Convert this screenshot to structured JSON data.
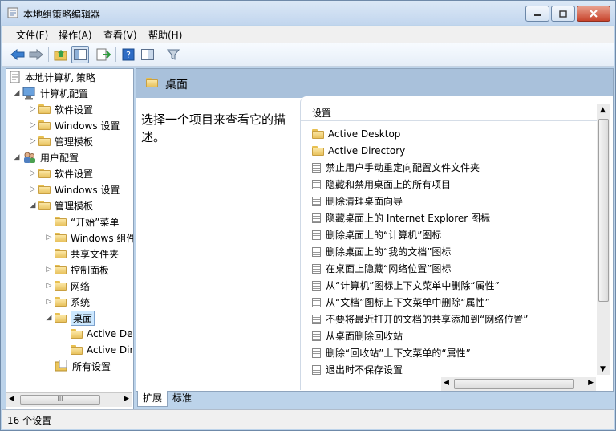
{
  "window": {
    "title": "本地组策略编辑器"
  },
  "menu": [
    "文件(F)",
    "操作(A)",
    "查看(V)",
    "帮助(H)"
  ],
  "tree": {
    "root": "本地计算机 策略",
    "computer": "计算机配置",
    "user": "用户配置",
    "sw1": "软件设置",
    "win1": "Windows 设置",
    "adm1": "管理模板",
    "sw2": "软件设置",
    "win2": "Windows 设置",
    "adm2": "管理模板",
    "start": "“开始”菜单",
    "wincomp": "Windows 组件",
    "shared": "共享文件夹",
    "ctrl": "控制面板",
    "net": "网络",
    "sys": "系统",
    "desktop": "桌面",
    "ad1": "Active Desktop",
    "ad2": "Active Directory",
    "all": "所有设置"
  },
  "right": {
    "header_title": "桌面",
    "description": "选择一个项目来查看它的描述。",
    "column_header": "设置",
    "items": [
      "Active Desktop",
      "Active Directory",
      "禁止用户手动重定向配置文件文件夹",
      "隐藏和禁用桌面上的所有项目",
      "删除清理桌面向导",
      "隐藏桌面上的 Internet Explorer 图标",
      "删除桌面上的“计算机”图标",
      "删除桌面上的“我的文档”图标",
      "在桌面上隐藏“网络位置”图标",
      "从“计算机”图标上下文菜单中删除“属性”",
      "从“文档”图标上下文菜单中删除“属性”",
      "不要将最近打开的文档的共享添加到“网络位置”",
      "从桌面删除回收站",
      "删除“回收站”上下文菜单的“属性”",
      "退出时不保存设置"
    ]
  },
  "tabs": {
    "extended": "扩展",
    "standard": "标准"
  },
  "status": "16 个设置",
  "scroll": {
    "grip": "III"
  }
}
